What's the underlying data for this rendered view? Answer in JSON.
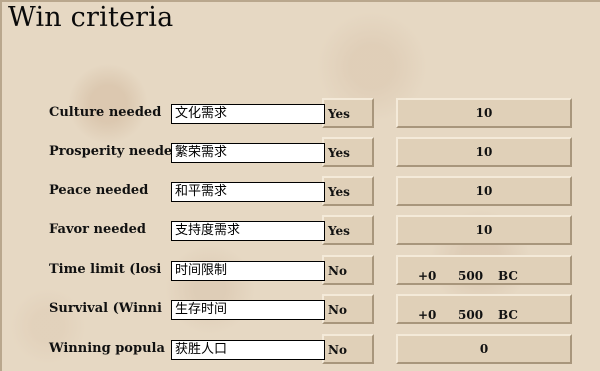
{
  "window": {
    "title": "Win criteria"
  },
  "criteria": [
    {
      "label": "Culture needed",
      "overlay": "文化需求",
      "toggle": "Yes",
      "value": "10"
    },
    {
      "label": "Prosperity neede",
      "overlay": "繁荣需求",
      "toggle": "Yes",
      "value": "10"
    },
    {
      "label": "Peace needed",
      "overlay": "和平需求",
      "toggle": "Yes",
      "value": "10"
    },
    {
      "label": "Favor needed",
      "overlay": "支持度需求",
      "toggle": "Yes",
      "value": "10"
    },
    {
      "label": "Time limit (losi",
      "overlay": "时间限制",
      "toggle": "No",
      "offset": "+0",
      "year": "500",
      "era": "BC"
    },
    {
      "label": "Survival (Winni",
      "overlay": "生存时间",
      "toggle": "No",
      "offset": "+0",
      "year": "500",
      "era": "BC"
    },
    {
      "label": "Winning popula",
      "overlay": "获胜人口",
      "toggle": "No",
      "value": "0"
    }
  ]
}
